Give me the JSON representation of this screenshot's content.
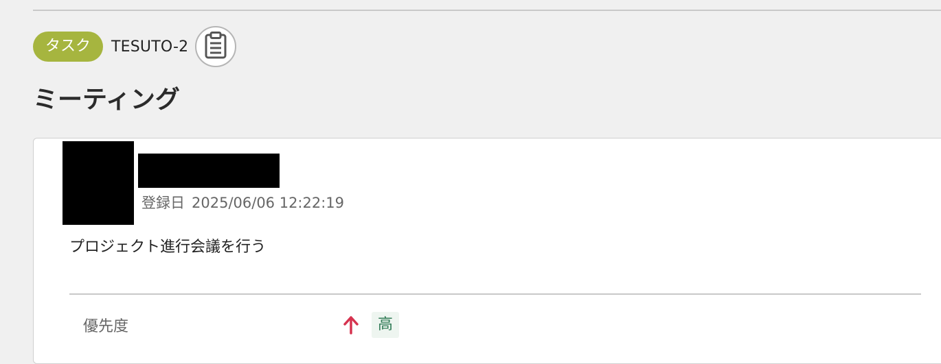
{
  "issue": {
    "type_label": "タスク",
    "type_color": "#a6b53f",
    "key": "TESUTO-2",
    "title": "ミーティング",
    "copy_icon": "clipboard-icon"
  },
  "comment": {
    "created_label": "登録日",
    "created_value": "2025/06/06 12:22:19",
    "description": "プロジェクト進行会議を行う"
  },
  "fields": {
    "priority_label": "優先度",
    "priority_icon": "arrow-up-icon",
    "priority_icon_color": "#d6334f",
    "priority_value": "高"
  }
}
